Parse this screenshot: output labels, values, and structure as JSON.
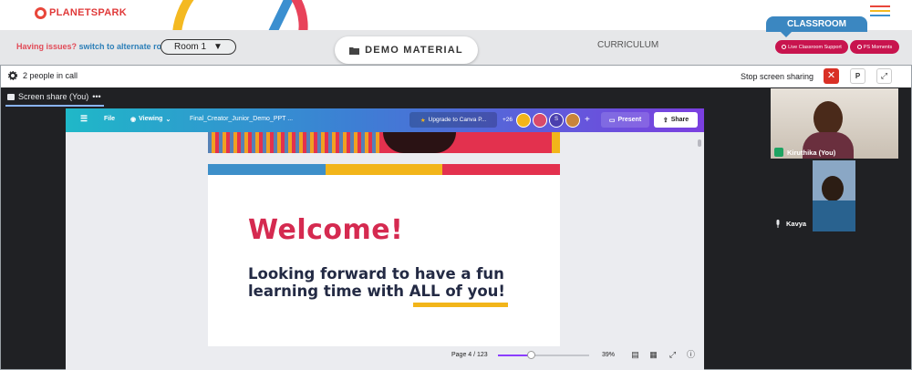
{
  "header": {
    "brand": "PLANETSPARK",
    "classroom_tab": "CLASSROOM"
  },
  "subheader": {
    "issues_text": "Having issues?",
    "alt_room_link": "switch to alternate room",
    "room_select": "Room 1",
    "demo_material": "DEMO MATERIAL",
    "curriculum": "CURRICULUM",
    "live_support": "Live Classroom Support",
    "ps_moments": "PS Moments"
  },
  "call": {
    "people_count": "2 people in call",
    "stop_sharing": "Stop screen sharing",
    "present_button": "P",
    "share_tab": "Screen share (You)",
    "more": "•••"
  },
  "canva": {
    "file": "File",
    "viewing": "Viewing",
    "doc_title": "Final_Creator_Junior_Demo_PPT ...",
    "upgrade": "Upgrade to Canva P...",
    "collab_count": "+26",
    "avatar_s": "S",
    "present": "Present",
    "share": "Share",
    "page_info": "Page 4 / 123",
    "zoom": "39%",
    "zoom_level": 0.36
  },
  "slide": {
    "welcome": "Welcome!",
    "line1": "Looking forward to have a fun",
    "line2": "learning time with ALL of you!"
  },
  "participants": [
    {
      "name": "Kiruthika (You)"
    },
    {
      "name": "Kavya"
    }
  ],
  "colors": {
    "accent_red": "#d52a50",
    "blue": "#3d8fc9",
    "yellow": "#f2b51a",
    "pink": "#e3314e",
    "navy": "#232a44"
  }
}
